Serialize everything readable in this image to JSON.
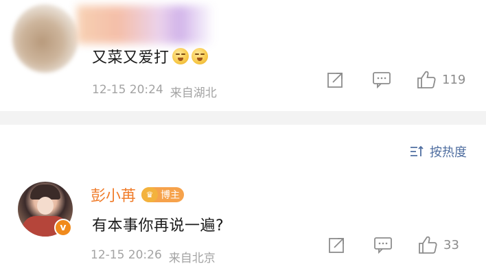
{
  "comments": [
    {
      "text": "又菜又爱打",
      "emojis": [
        "emoji-face",
        "emoji-face"
      ],
      "date": "12-15 20:24",
      "location": "来自湖北",
      "like_count": "119"
    },
    {
      "author": "彭小苒",
      "author_badge": "博主",
      "verified_badge": "v",
      "text": "有本事你再说一遍?",
      "date": "12-15 20:26",
      "location": "来自北京",
      "like_count": "33"
    }
  ],
  "sort": {
    "label": "按热度"
  },
  "colors": {
    "author_orange": "#f07c2a",
    "sort_blue": "#4f6ea0",
    "meta_gray": "#a3a3a3",
    "divider_gray": "#f3f3f3"
  },
  "icons": [
    "share-icon",
    "comment-icon",
    "like-icon",
    "sort-icon",
    "crown-icon"
  ]
}
